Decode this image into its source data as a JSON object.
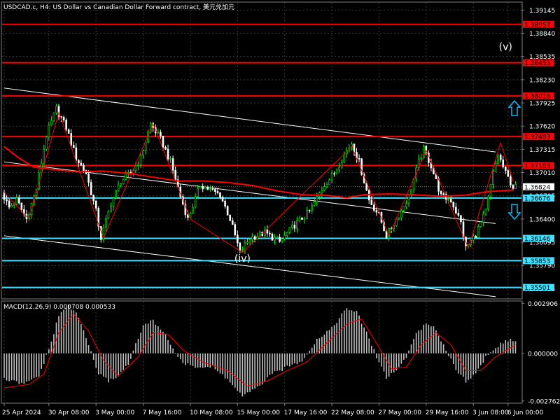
{
  "chart_data": {
    "type": "candlestick",
    "symbol_title": "USDCAD.c, H4:  US Dollar vs Canadian Dollar Forward contract, 美元兑加元",
    "price_ticks": [
      "1.39145",
      "1.38840",
      "1.38535",
      "1.38230",
      "1.37925",
      "1.37620",
      "1.37315",
      "1.37010",
      "1.36705",
      "1.36400",
      "1.36095",
      "1.35790",
      "1.35485"
    ],
    "price_range": [
      1.3536,
      1.3924
    ],
    "price_tick_values": [
      1.39145,
      1.3884,
      1.38535,
      1.3823,
      1.37925,
      1.3762,
      1.37315,
      1.3701,
      1.36705,
      1.364,
      1.36095,
      1.3579,
      1.35485
    ],
    "time_labels": [
      "25 Apr 2024",
      "30 Apr 08:00",
      "3 May 00:00",
      "7 May 16:00",
      "10 May 08:00",
      "15 May 00:00",
      "17 May 16:00",
      "22 May 08:00",
      "27 May 00:00",
      "29 May 16:00",
      "3 Jun 08:00",
      "6 Jun 00:00"
    ],
    "bar_count": 207,
    "time_label_bar_index": [
      0,
      18,
      37,
      56,
      75,
      94,
      113,
      132,
      151,
      170,
      189,
      203
    ],
    "current_price": {
      "value": 1.36824,
      "label": "1.36824"
    },
    "levels_red": [
      {
        "value": 1.38957,
        "label": "1.38957"
      },
      {
        "value": 1.38453,
        "label": "1.38453"
      },
      {
        "value": 1.38016,
        "label": "1.38016"
      },
      {
        "value": 1.37483,
        "label": "1.37483"
      },
      {
        "value": 1.37103,
        "label": "1.37103"
      }
    ],
    "levels_cyan": [
      {
        "value": 1.36676,
        "label": "1.36676"
      },
      {
        "value": 1.36146,
        "label": "1.36146"
      },
      {
        "value": 1.35853,
        "label": "1.35853"
      },
      {
        "value": 1.35501,
        "label": "1.35501"
      }
    ],
    "annotations": [
      {
        "text": "(v)",
        "bar": 202,
        "price": 1.3862
      },
      {
        "text": "(iv)",
        "bar": 96,
        "price": 1.3584
      }
    ],
    "arrows": [
      {
        "direction": "up",
        "bar": 208,
        "price": 1.3785,
        "color": "#00bfff"
      },
      {
        "direction": "down",
        "bar": 208,
        "price": 1.365,
        "color": "#00bfff"
      }
    ],
    "channel_lines": [
      {
        "from": [
          0,
          1.3812
        ],
        "to": [
          198,
          1.3728
        ],
        "color": "#ffffff"
      },
      {
        "from": [
          0,
          1.3715
        ],
        "to": [
          198,
          1.3634
        ],
        "color": "#ffffff"
      },
      {
        "from": [
          0,
          1.3618
        ],
        "to": [
          198,
          1.3538
        ],
        "color": "#ffffff"
      }
    ],
    "moving_average": {
      "color": "#ff0000",
      "points": [
        [
          0,
          1.3735
        ],
        [
          6,
          1.372
        ],
        [
          12,
          1.3708
        ],
        [
          20,
          1.3705
        ],
        [
          30,
          1.3702
        ],
        [
          40,
          1.3703
        ],
        [
          50,
          1.37
        ],
        [
          60,
          1.3695
        ],
        [
          70,
          1.369
        ],
        [
          80,
          1.369
        ],
        [
          90,
          1.3688
        ],
        [
          100,
          1.3684
        ],
        [
          110,
          1.3677
        ],
        [
          120,
          1.3672
        ],
        [
          130,
          1.3671
        ],
        [
          138,
          1.3668
        ],
        [
          145,
          1.3672
        ],
        [
          155,
          1.3673
        ],
        [
          165,
          1.3672
        ],
        [
          175,
          1.367
        ],
        [
          185,
          1.3671
        ],
        [
          195,
          1.3676
        ],
        [
          205,
          1.3678
        ]
      ]
    },
    "zigzag": {
      "color": "#ff0000",
      "points": [
        [
          0,
          1.3675
        ],
        [
          10,
          1.364
        ],
        [
          22,
          1.378
        ],
        [
          40,
          1.3615
        ],
        [
          60,
          1.3765
        ],
        [
          75,
          1.364
        ],
        [
          96,
          1.3596
        ],
        [
          140,
          1.3735
        ],
        [
          155,
          1.3618
        ],
        [
          170,
          1.373
        ],
        [
          187,
          1.3602
        ],
        [
          200,
          1.374
        ],
        [
          205,
          1.369
        ]
      ]
    },
    "price_path": [
      [
        0,
        1.3675
      ],
      [
        3,
        1.3655
      ],
      [
        6,
        1.3665
      ],
      [
        10,
        1.364
      ],
      [
        14,
        1.368
      ],
      [
        18,
        1.375
      ],
      [
        22,
        1.3785
      ],
      [
        26,
        1.376
      ],
      [
        30,
        1.372
      ],
      [
        34,
        1.37
      ],
      [
        38,
        1.365
      ],
      [
        40,
        1.3615
      ],
      [
        44,
        1.366
      ],
      [
        48,
        1.369
      ],
      [
        52,
        1.37
      ],
      [
        56,
        1.372
      ],
      [
        60,
        1.3765
      ],
      [
        64,
        1.3745
      ],
      [
        68,
        1.3715
      ],
      [
        72,
        1.367
      ],
      [
        75,
        1.364
      ],
      [
        80,
        1.3685
      ],
      [
        84,
        1.3678
      ],
      [
        88,
        1.3672
      ],
      [
        92,
        1.364
      ],
      [
        96,
        1.3596
      ],
      [
        100,
        1.3615
      ],
      [
        106,
        1.3622
      ],
      [
        112,
        1.361
      ],
      [
        118,
        1.3632
      ],
      [
        124,
        1.365
      ],
      [
        130,
        1.3685
      ],
      [
        134,
        1.37
      ],
      [
        138,
        1.3725
      ],
      [
        141,
        1.374
      ],
      [
        144,
        1.3715
      ],
      [
        148,
        1.3665
      ],
      [
        152,
        1.3645
      ],
      [
        155,
        1.3618
      ],
      [
        160,
        1.3645
      ],
      [
        164,
        1.367
      ],
      [
        168,
        1.3715
      ],
      [
        170,
        1.3732
      ],
      [
        173,
        1.371
      ],
      [
        177,
        1.367
      ],
      [
        181,
        1.3665
      ],
      [
        185,
        1.3635
      ],
      [
        187,
        1.3602
      ],
      [
        191,
        1.362
      ],
      [
        195,
        1.365
      ],
      [
        198,
        1.37
      ],
      [
        200,
        1.3725
      ],
      [
        203,
        1.37
      ],
      [
        206,
        1.3682
      ]
    ],
    "macd": {
      "label": "MACD(12,26,9) 0.000708 0.000533",
      "ticks": [
        "0.002906",
        "0.000000",
        "-0.002762"
      ],
      "tick_values": [
        0.002906,
        0.0,
        -0.002762
      ],
      "range": [
        -0.00285,
        0.003
      ],
      "signal_color": "#ff0000",
      "hist_points": [
        [
          0,
          -0.0015
        ],
        [
          8,
          -0.0018
        ],
        [
          14,
          -0.0013
        ],
        [
          18,
          0.0002
        ],
        [
          22,
          0.0022
        ],
        [
          26,
          0.0028
        ],
        [
          30,
          0.0021
        ],
        [
          34,
          0.0005
        ],
        [
          38,
          -0.0012
        ],
        [
          42,
          -0.0016
        ],
        [
          46,
          -0.0013
        ],
        [
          50,
          -0.0006
        ],
        [
          56,
          0.0016
        ],
        [
          60,
          0.0019
        ],
        [
          64,
          0.0013
        ],
        [
          68,
          0.0003
        ],
        [
          72,
          -0.0006
        ],
        [
          78,
          -0.0008
        ],
        [
          84,
          -0.0008
        ],
        [
          90,
          -0.0015
        ],
        [
          96,
          -0.0025
        ],
        [
          102,
          -0.002
        ],
        [
          108,
          -0.0012
        ],
        [
          114,
          -0.0008
        ],
        [
          120,
          -0.0004
        ],
        [
          126,
          0.0008
        ],
        [
          132,
          0.0015
        ],
        [
          138,
          0.0026
        ],
        [
          142,
          0.0024
        ],
        [
          146,
          0.0012
        ],
        [
          150,
          -0.0002
        ],
        [
          154,
          -0.0014
        ],
        [
          158,
          -0.001
        ],
        [
          162,
          -0.0002
        ],
        [
          166,
          0.0012
        ],
        [
          170,
          0.0017
        ],
        [
          174,
          0.0014
        ],
        [
          178,
          0.0002
        ],
        [
          182,
          -0.0009
        ],
        [
          186,
          -0.0016
        ],
        [
          190,
          -0.0012
        ],
        [
          194,
          -0.0002
        ],
        [
          198,
          0.0003
        ],
        [
          202,
          0.0008
        ],
        [
          206,
          0.0007
        ]
      ],
      "signal_points": [
        [
          0,
          -0.002
        ],
        [
          10,
          -0.0018
        ],
        [
          16,
          -0.0012
        ],
        [
          22,
          0.0012
        ],
        [
          28,
          0.0023
        ],
        [
          34,
          0.0013
        ],
        [
          40,
          -0.0004
        ],
        [
          46,
          -0.0013
        ],
        [
          54,
          -0.0002
        ],
        [
          60,
          0.0012
        ],
        [
          66,
          0.0011
        ],
        [
          72,
          0.0002
        ],
        [
          80,
          -0.0005
        ],
        [
          90,
          -0.001
        ],
        [
          98,
          -0.0019
        ],
        [
          106,
          -0.0016
        ],
        [
          114,
          -0.001
        ],
        [
          122,
          -0.0005
        ],
        [
          130,
          0.0006
        ],
        [
          138,
          0.0017
        ],
        [
          144,
          0.002
        ],
        [
          150,
          0.0006
        ],
        [
          156,
          -0.0009
        ],
        [
          162,
          -0.0008
        ],
        [
          168,
          0.0005
        ],
        [
          174,
          0.0012
        ],
        [
          180,
          0.0005
        ],
        [
          186,
          -0.001
        ],
        [
          192,
          -0.001
        ],
        [
          198,
          -0.0002
        ],
        [
          206,
          0.0005
        ]
      ]
    }
  }
}
